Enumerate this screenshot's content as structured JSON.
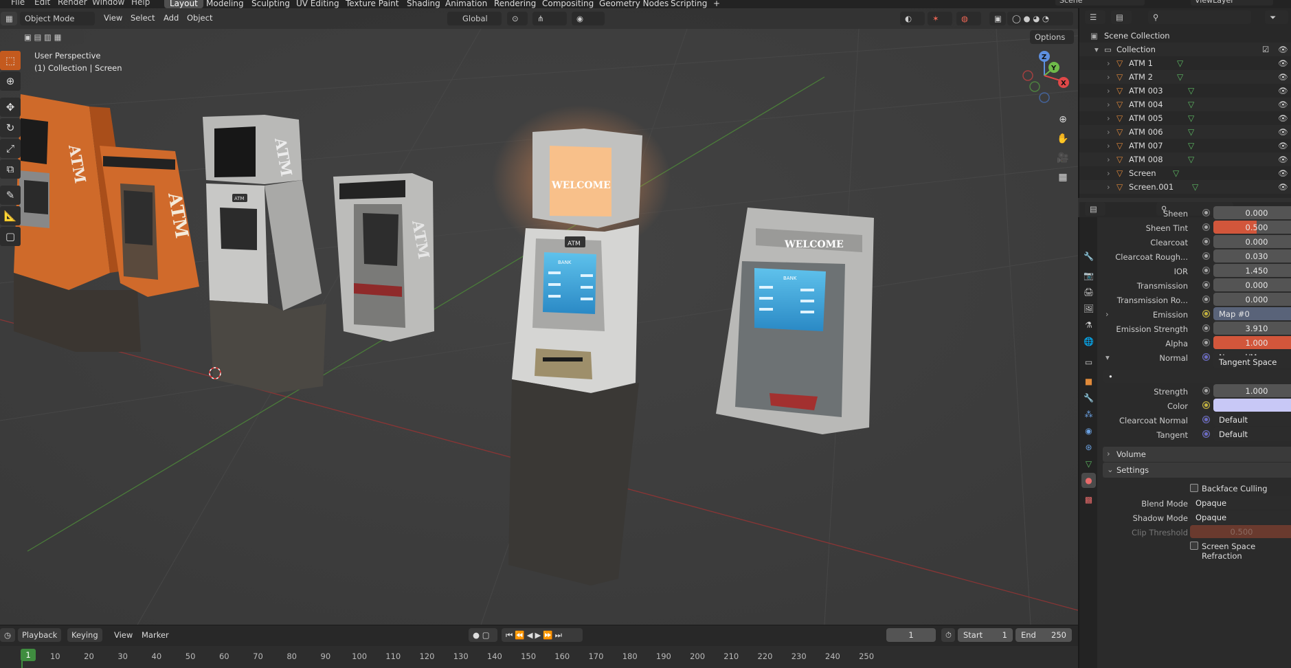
{
  "top_menu": [
    "File",
    "Edit",
    "Render",
    "Window",
    "Help"
  ],
  "workspaces": [
    "Layout",
    "Modeling",
    "Sculpting",
    "UV Editing",
    "Texture Paint",
    "Shading",
    "Animation",
    "Rendering",
    "Compositing",
    "Geometry Nodes",
    "Scripting"
  ],
  "active_workspace": "Layout",
  "add_workspace": "+",
  "scene_name": "Scene",
  "view_layer": "ViewLayer",
  "viewport": {
    "mode": "Object Mode",
    "menus": [
      "View",
      "Select",
      "Add",
      "Object"
    ],
    "orientation": "Global",
    "options_label": "Options",
    "perspective_label": "User Perspective",
    "context_label": "(1) Collection | Screen",
    "welcome_sign_1": "WELCOME",
    "welcome_sign_2": "WELCOME",
    "atm_side_text": "ATM",
    "atm_header_badge": "ATM",
    "bank_screen_text": "BANK",
    "gizmo_z": "Z",
    "gizmo_y": "Y",
    "gizmo_x": "X"
  },
  "outliner": {
    "root": "Scene Collection",
    "collection": "Collection",
    "items": [
      "ATM 1",
      "ATM 2",
      "ATM 003",
      "ATM 004",
      "ATM 005",
      "ATM 006",
      "ATM 007",
      "ATM 008",
      "Screen",
      "Screen.001"
    ]
  },
  "properties": {
    "rows": [
      {
        "label": "Sheen",
        "value": "0.000",
        "style": "num"
      },
      {
        "label": "Sheen Tint",
        "value": "0.500",
        "style": "fill",
        "fill": 0.5
      },
      {
        "label": "Clearcoat",
        "value": "0.000",
        "style": "num"
      },
      {
        "label": "Clearcoat Rough...",
        "value": "0.030",
        "style": "num"
      },
      {
        "label": "IOR",
        "value": "1.450",
        "style": "num"
      },
      {
        "label": "Transmission",
        "value": "0.000",
        "style": "num"
      },
      {
        "label": "Transmission Ro...",
        "value": "0.000",
        "style": "num"
      },
      {
        "label": "Emission",
        "value": "Map #0",
        "style": "link"
      },
      {
        "label": "Emission Strength",
        "value": "3.910",
        "style": "num"
      },
      {
        "label": "Alpha",
        "value": "1.000",
        "style": "fill",
        "fill": 1.0
      },
      {
        "label": "Normal",
        "value": "Normal/Map",
        "style": "link-dark"
      }
    ],
    "tangent_space": "Tangent Space",
    "uv_field": "•",
    "strength_label": "Strength",
    "strength_value": "1.000",
    "color_label": "Color",
    "color_swatch": "#c8c8f6",
    "clearcoat_normal_label": "Clearcoat Normal",
    "clearcoat_normal_value": "Default",
    "tangent_label": "Tangent",
    "tangent_value": "Default",
    "volume_label": "Volume",
    "settings_label": "Settings",
    "backface_culling": "Backface Culling",
    "blend_mode_label": "Blend Mode",
    "blend_mode_value": "Opaque",
    "shadow_mode_label": "Shadow Mode",
    "shadow_mode_value": "Opaque",
    "clip_threshold_label": "Clip Threshold",
    "clip_threshold_value": "0.500",
    "screen_space_refraction": "Screen Space Refraction"
  },
  "timeline": {
    "menus": [
      "Playback",
      "Keying",
      "View",
      "Marker"
    ],
    "current_frame": "1",
    "start_label": "Start",
    "start_value": "1",
    "end_label": "End",
    "end_value": "250",
    "ticks": [
      "1",
      "10",
      "20",
      "30",
      "40",
      "50",
      "60",
      "70",
      "80",
      "90",
      "100",
      "110",
      "120",
      "130",
      "140",
      "150",
      "160",
      "170",
      "180",
      "190",
      "200",
      "210",
      "220",
      "230",
      "240",
      "250"
    ]
  },
  "colors": {
    "accent_blue": "#5680c2",
    "orange_active": "#c45a1e",
    "fill_red": "#d2563b",
    "frame_green": "#3f8d3f"
  }
}
